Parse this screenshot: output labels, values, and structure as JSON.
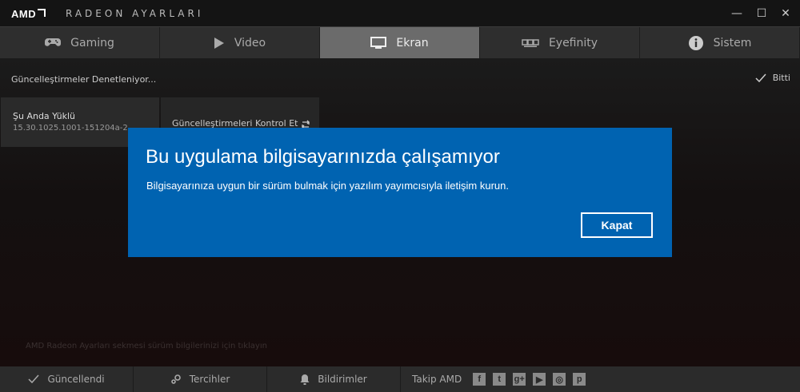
{
  "titlebar": {
    "brand": "AMD",
    "title": "RADEON AYARLARI",
    "minimize": "—",
    "maximize": "☐",
    "close": "✕"
  },
  "tabs": [
    {
      "label": "Gaming",
      "icon": "gamepad-icon"
    },
    {
      "label": "Video",
      "icon": "play-icon"
    },
    {
      "label": "Ekran",
      "icon": "monitor-icon",
      "active": true
    },
    {
      "label": "Eyefinity",
      "icon": "multi-display-icon"
    },
    {
      "label": "Sistem",
      "icon": "info-icon"
    }
  ],
  "status": {
    "checking": "Güncelleştirmeler Denetleniyor...",
    "done": "Bitti"
  },
  "current": {
    "label": "Şu Anda Yüklü",
    "version": "15.30.1025.1001-151204a-2..."
  },
  "check_updates": {
    "label": "Güncelleştirmeleri Kontrol Et"
  },
  "dialog": {
    "title": "Bu uygulama bilgisayarınızda çalışamıyor",
    "message": "Bilgisayarınıza uygun bir sürüm bulmak için yazılım yayımcısıyla iletişim kurun.",
    "button": "Kapat",
    "color": "#0063b1"
  },
  "background_text": "AMD Radeon Ayarları sekmesi sürüm bilgilerinizi için tıklayın",
  "bottombar": {
    "updated": "Güncellendi",
    "preferences": "Tercihler",
    "notifications": "Bildirimler",
    "follow": "Takip AMD",
    "social": [
      "f",
      "t",
      "g+",
      "▶",
      "◎",
      "p"
    ]
  }
}
